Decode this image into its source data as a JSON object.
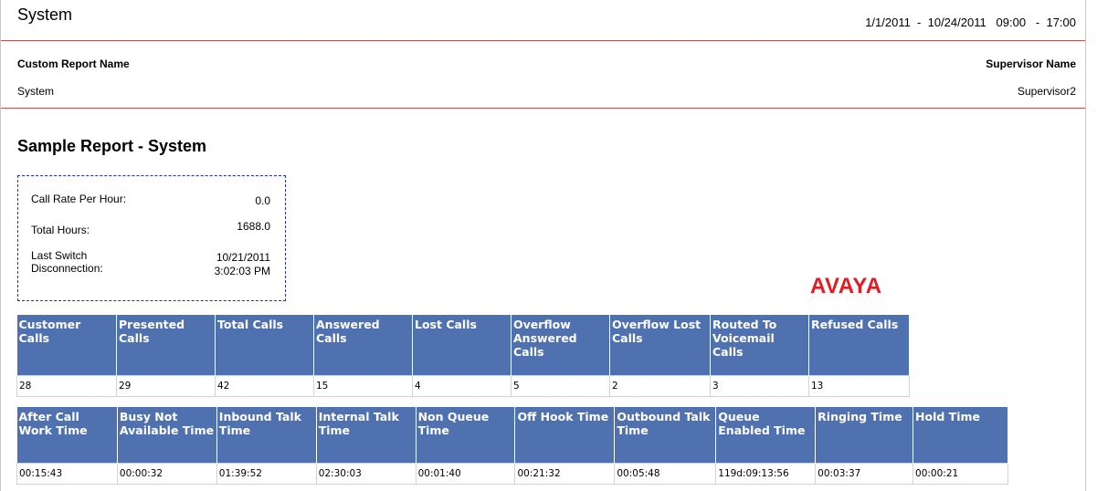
{
  "header": {
    "title": "System",
    "date_range": "1/1/2011  -  10/24/2011",
    "time_range": "09:00   -  17:00"
  },
  "meta": {
    "report_name_label": "Custom Report Name",
    "report_name_value": "System",
    "supervisor_label": "Supervisor Name",
    "supervisor_value": "Supervisor2"
  },
  "report_title": "Sample Report - System",
  "stats": [
    {
      "label": "Call Rate Per Hour:",
      "value": "0.0"
    },
    {
      "label": "Total Hours:",
      "value": "1688.0"
    },
    {
      "label": "Last Switch Disconnection:",
      "value": "10/21/2011 3:02:03 PM"
    }
  ],
  "logo_text": "AVAYA",
  "table1": {
    "headers": [
      "Customer Calls",
      "Presented Calls",
      "Total Calls",
      "Answered Calls",
      "Lost Calls",
      "Overflow Answered Calls",
      "Overflow Lost Calls",
      "Routed To Voicemail Calls",
      "Refused Calls"
    ],
    "values": [
      "28",
      "29",
      "42",
      "15",
      "4",
      "5",
      "2",
      "3",
      "13"
    ]
  },
  "table2": {
    "headers": [
      "After Call Work Time",
      "Busy Not Available Time",
      "Inbound Talk Time",
      "Internal Talk Time",
      "Non Queue Time",
      "Off Hook Time",
      "Outbound Talk Time",
      "Queue Enabled Time",
      "Ringing Time",
      "Hold Time"
    ],
    "values": [
      "00:15:43",
      "00:00:32",
      "01:39:52",
      "02:30:03",
      "00:01:40",
      "00:21:32",
      "00:05:48",
      "119d:09:13:56",
      "00:03:37",
      "00:00:21"
    ]
  }
}
